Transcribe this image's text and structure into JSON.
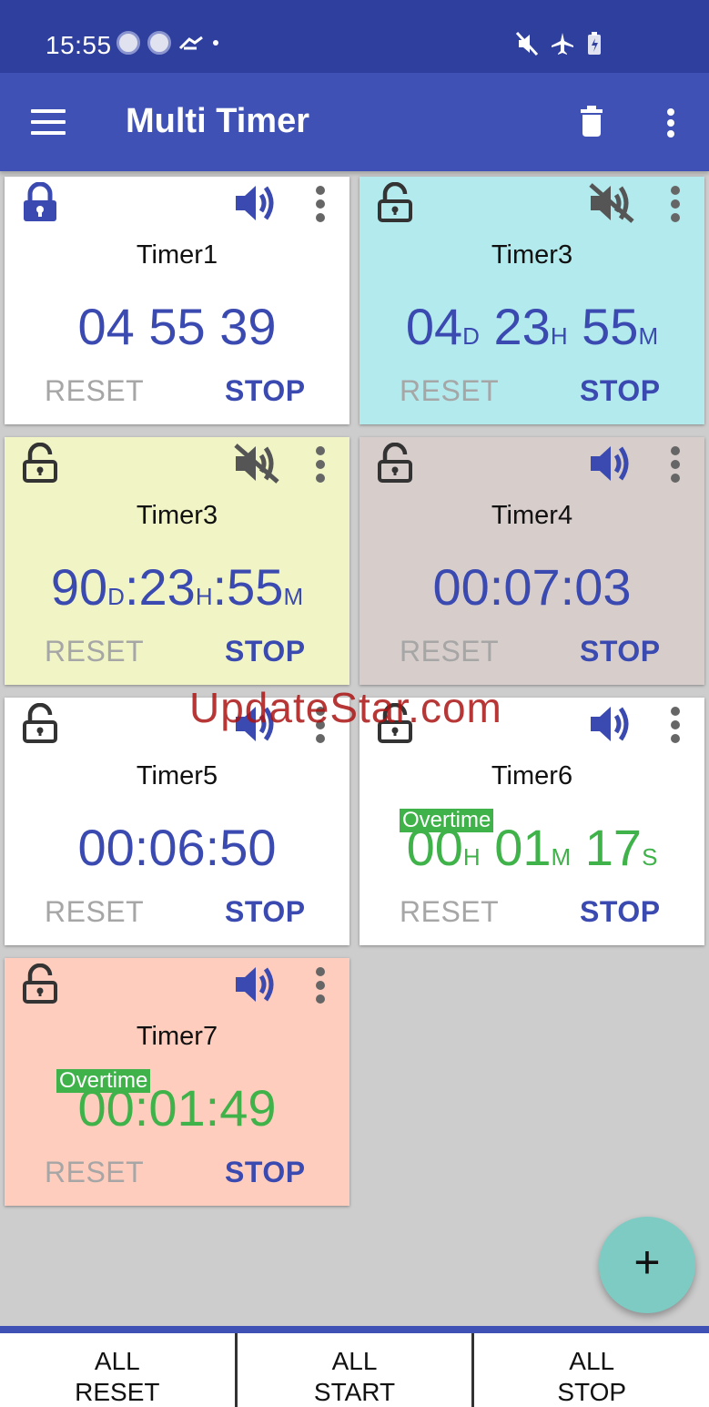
{
  "status_bar": {
    "time": "15:55"
  },
  "app_bar": {
    "title": "Multi Timer"
  },
  "timers": [
    {
      "name": "Timer1",
      "bg": "#ffffff",
      "locked": true,
      "muted": false,
      "parts": [
        {
          "v": "04 55 39",
          "u": ""
        }
      ],
      "color": "blue",
      "overtime": "",
      "reset": "RESET",
      "stop": "STOP"
    },
    {
      "name": "Timer3",
      "bg": "#b3eaed",
      "locked": false,
      "muted": true,
      "parts": [
        {
          "v": "04",
          "u": "D"
        },
        {
          "v": " 23",
          "u": "H"
        },
        {
          "v": " 55",
          "u": "M"
        }
      ],
      "color": "blue",
      "overtime": "",
      "reset": "RESET",
      "stop": "STOP"
    },
    {
      "name": "Timer3",
      "bg": "#f1f5c6",
      "locked": false,
      "muted": true,
      "parts": [
        {
          "v": "90",
          "u": "D"
        },
        {
          "v": ":23",
          "u": "H"
        },
        {
          "v": ":55",
          "u": "M"
        }
      ],
      "color": "blue",
      "overtime": "",
      "reset": "RESET",
      "stop": "STOP"
    },
    {
      "name": "Timer4",
      "bg": "#d7cdcb",
      "locked": false,
      "muted": false,
      "parts": [
        {
          "v": "00:07:03",
          "u": ""
        }
      ],
      "color": "blue",
      "overtime": "",
      "reset": "RESET",
      "stop": "STOP"
    },
    {
      "name": "Timer5",
      "bg": "#ffffff",
      "locked": false,
      "muted": false,
      "parts": [
        {
          "v": "00:06:50",
          "u": ""
        }
      ],
      "color": "blue",
      "overtime": "",
      "reset": "RESET",
      "stop": "STOP"
    },
    {
      "name": "Timer6",
      "bg": "#ffffff",
      "locked": false,
      "muted": false,
      "parts": [
        {
          "v": "00",
          "u": "H"
        },
        {
          "v": " 01",
          "u": "M"
        },
        {
          "v": " 17",
          "u": "S"
        }
      ],
      "color": "green",
      "overtime": "Overtime",
      "reset": "RESET",
      "stop": "STOP"
    },
    {
      "name": "Timer7",
      "bg": "#fecdbd",
      "locked": false,
      "muted": false,
      "parts": [
        {
          "v": "00:01:49",
          "u": ""
        }
      ],
      "color": "green",
      "overtime": "Overtime",
      "reset": "RESET",
      "stop": "STOP"
    }
  ],
  "watermark": "UpdateStar.com",
  "fab": {
    "label": "+"
  },
  "bottom_bar": {
    "reset": [
      "ALL",
      "RESET"
    ],
    "start": [
      "ALL",
      "START"
    ],
    "stop": [
      "ALL",
      "STOP"
    ]
  },
  "colors": {
    "primary": "#3f51b5",
    "status_bar": "#2f3f9d",
    "timer_blue": "#3a4ab0",
    "overtime_green": "#3fb24a",
    "fab": "#7ecbc3"
  }
}
